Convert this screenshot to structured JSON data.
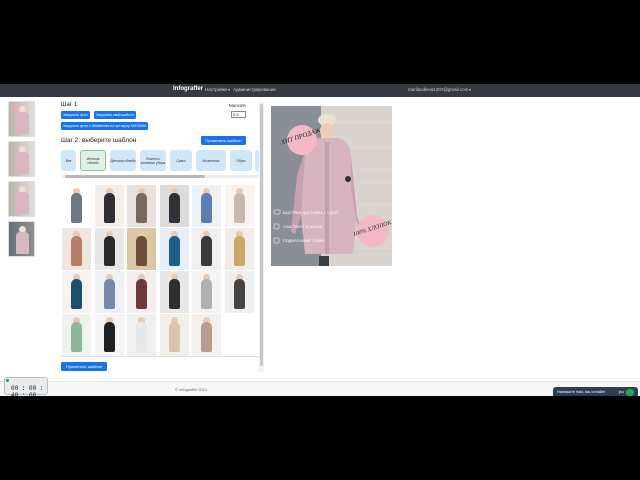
{
  "navbar": {
    "brand": "Infograffer",
    "settings_label": "Настройки",
    "admin_label": "Администрирование",
    "user_email": "marilavdieva1407@gmail.com"
  },
  "step1": {
    "title": "Шаг 1",
    "upload_photo": "Загрузить фото",
    "upload_own_template": "Загрузить свой шаблон",
    "upload_by_article": "Загрузить фото с Wildberries по артикулу 43375536"
  },
  "mask": {
    "label": "Маска%",
    "value": "0.5"
  },
  "step2": {
    "title": "Шаг 2: выберите шаблон",
    "apply_button": "Применить шаблон",
    "categories": [
      {
        "label": "Все"
      },
      {
        "label": "Женская одежда"
      },
      {
        "label": "Детская одежда"
      },
      {
        "label": "Платья и головные уборы"
      },
      {
        "label": "Сумки"
      },
      {
        "label": "Косметика"
      },
      {
        "label": "Обувь"
      }
    ]
  },
  "apply_bottom": "Применить шаблон",
  "preview": {
    "badge_top": "ХИТ ПРОДАЖ",
    "badge_bottom": "100% ХЛОПОК",
    "feature_1": "БЫСТРАЯ ДОСТАВКА 1 3 ДНЯ",
    "feature_2": "УЧАСТВУЕТ В АКЦИИ",
    "feature_3": "ПОДАРОЧНЫЙ ТОВАР"
  },
  "footer": {
    "text": "© Infograffer 2021"
  },
  "chat": {
    "text": "Напишите нам, мы онлайн!",
    "badge": "jivo"
  },
  "timer": {
    "value": "00 : 00 : 40 : 00"
  },
  "colors": {
    "primary": "#1a73e8",
    "navbar": "#343a40",
    "category_bg": "#cfe7f7"
  }
}
